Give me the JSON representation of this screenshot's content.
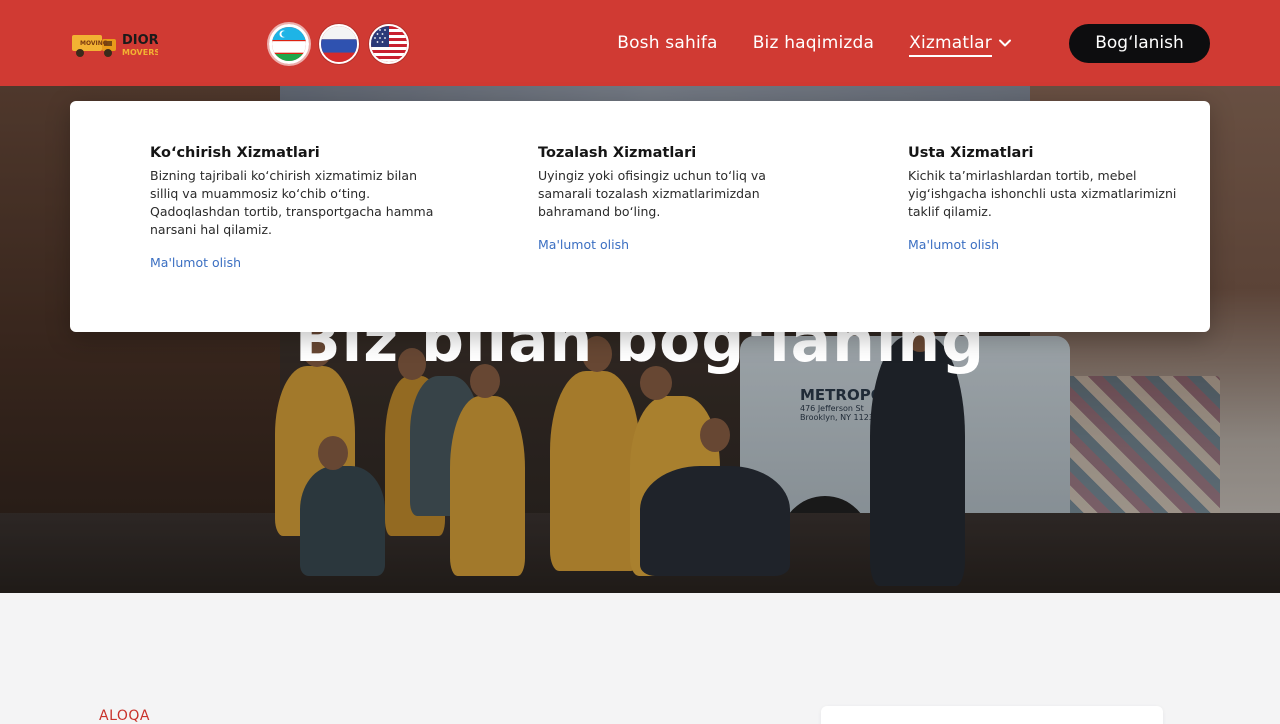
{
  "brand": {
    "logo_text_top": "DIOR",
    "logo_text_bottom": "MOVERS",
    "truck_text": "MOVING",
    "colors": {
      "header": "#d03a33",
      "accent": "#c9322b",
      "link": "#3b6fc2"
    }
  },
  "languages": [
    {
      "name": "uz-flag-icon",
      "active": true
    },
    {
      "name": "ru-flag-icon",
      "active": false
    },
    {
      "name": "us-flag-icon",
      "active": false
    }
  ],
  "nav": {
    "home": "Bosh sahifa",
    "about": "Biz haqimizda",
    "services": "Xizmatlar",
    "contact_button": "Bog‘lanish"
  },
  "hero": {
    "title": "Biz bilan bog‘laning",
    "truck_sign": "METROPOLIS",
    "truck_address": "476 Jefferson St Brooklyn, NY 11237"
  },
  "services_menu": [
    {
      "title": "Ko‘chirish Xizmatlari",
      "description": "Bizning tajribali ko‘chirish xizmatimiz bilan silliq va muammosiz ko‘chib o‘ting. Qadoqlashdan tortib, transportgacha hamma narsani hal qilamiz.",
      "link": "Ma'lumot olish"
    },
    {
      "title": "Tozalash Xizmatlari",
      "description": "Uyingiz yoki ofisingiz uchun to‘liq va samarali tozalash xizmatlarimizdan bahramand bo‘ling.",
      "link": "Ma'lumot olish"
    },
    {
      "title": "Usta Xizmatlari",
      "description": "Kichik ta’mirlashlardan tortib, mebel yig‘ishgacha ishonchli usta xizmatlarimizni taklif qilamiz.",
      "link": "Ma'lumot olish"
    }
  ],
  "contact_section": {
    "label": "ALOQA"
  }
}
